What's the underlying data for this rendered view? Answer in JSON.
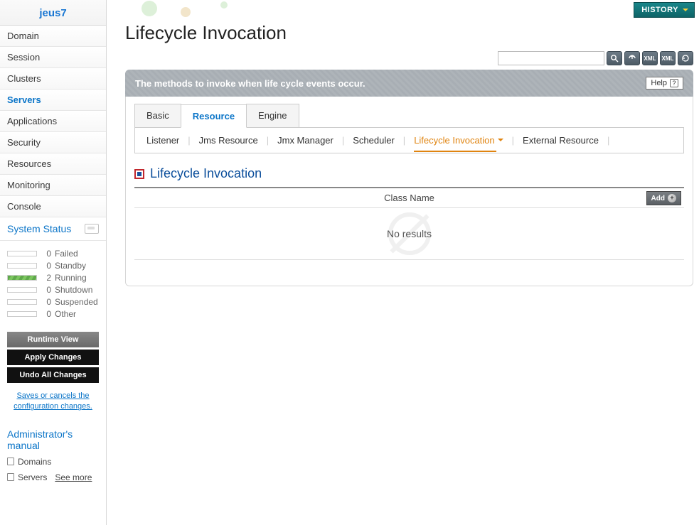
{
  "brand": "jeus7",
  "nav": {
    "domain": "Domain",
    "session": "Session",
    "clusters": "Clusters",
    "servers": "Servers",
    "applications": "Applications",
    "security": "Security",
    "resources": "Resources",
    "monitoring": "Monitoring",
    "console": "Console"
  },
  "systemStatus": {
    "title": "System Status",
    "items": [
      {
        "count": "0",
        "label": "Failed"
      },
      {
        "count": "0",
        "label": "Standby"
      },
      {
        "count": "2",
        "label": "Running"
      },
      {
        "count": "0",
        "label": "Shutdown"
      },
      {
        "count": "0",
        "label": "Suspended"
      },
      {
        "count": "0",
        "label": "Other"
      }
    ]
  },
  "buttons": {
    "runtimeView": "Runtime View",
    "applyChanges": "Apply Changes",
    "undoAll": "Undo All Changes"
  },
  "configNote": "Saves or cancels the configuration changes.",
  "manual": {
    "title": "Administrator's manual",
    "domains": "Domains",
    "servers": "Servers",
    "seeMore": "See more"
  },
  "topbar": {
    "history": "HISTORY"
  },
  "page": {
    "title": "Lifecycle Invocation",
    "description": "The methods to invoke when life cycle events occur.",
    "help": "Help"
  },
  "tabs": {
    "basic": "Basic",
    "resource": "Resource",
    "engine": "Engine"
  },
  "subtabs": {
    "listener": "Listener",
    "jmsResource": "Jms Resource",
    "jmxManager": "Jmx Manager",
    "scheduler": "Scheduler",
    "lifecycle": "Lifecycle Invocation",
    "external": "External Resource"
  },
  "section": {
    "title": "Lifecycle Invocation"
  },
  "table": {
    "header": "Class Name",
    "addLabel": "Add",
    "empty": "No results"
  },
  "toolbarIcons": {
    "xml1": "XML",
    "xml2": "XML"
  }
}
